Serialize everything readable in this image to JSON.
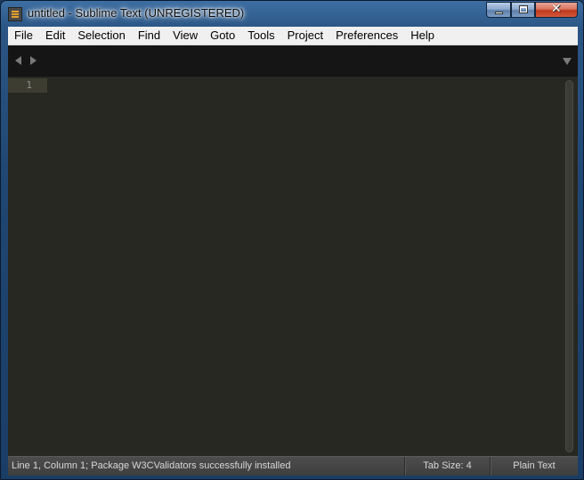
{
  "window": {
    "title": "untitled - Sublime Text (UNREGISTERED)",
    "controls": {
      "minimize": "minimize-icon",
      "maximize": "maximize-icon",
      "close": "close-icon",
      "close_glyph": "✕"
    }
  },
  "menu": [
    {
      "label": "File"
    },
    {
      "label": "Edit"
    },
    {
      "label": "Selection"
    },
    {
      "label": "Find"
    },
    {
      "label": "View"
    },
    {
      "label": "Goto"
    },
    {
      "label": "Tools"
    },
    {
      "label": "Project"
    },
    {
      "label": "Preferences"
    },
    {
      "label": "Help"
    }
  ],
  "editor": {
    "line_numbers": [
      "1"
    ],
    "content": "",
    "colors": {
      "background": "#272822",
      "gutter_highlight": "#3e3d32",
      "line_number": "#8f908a"
    }
  },
  "statusbar": {
    "message": "Line 1, Column 1; Package W3CValidators successfully installed",
    "tab_size": "Tab Size: 4",
    "syntax": "Plain Text"
  }
}
